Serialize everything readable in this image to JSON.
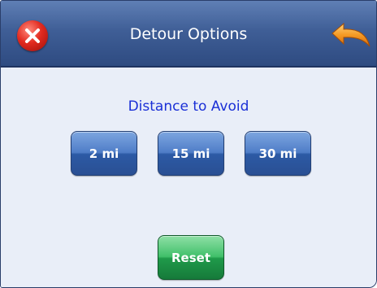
{
  "header": {
    "title": "Detour Options",
    "close_icon": "close-icon",
    "back_icon": "back-arrow-icon"
  },
  "main": {
    "heading": "Distance to Avoid",
    "options": [
      {
        "label": "2 mi"
      },
      {
        "label": "15 mi"
      },
      {
        "label": "30 mi"
      }
    ],
    "reset_label": "Reset"
  },
  "colors": {
    "titlebar": "#3f5e96",
    "heading_text": "#1a2fd6",
    "option_button": "#4f7dc7",
    "reset_button": "#41c06a",
    "close_button": "#e22a1f",
    "back_arrow": "#f28a1a"
  }
}
